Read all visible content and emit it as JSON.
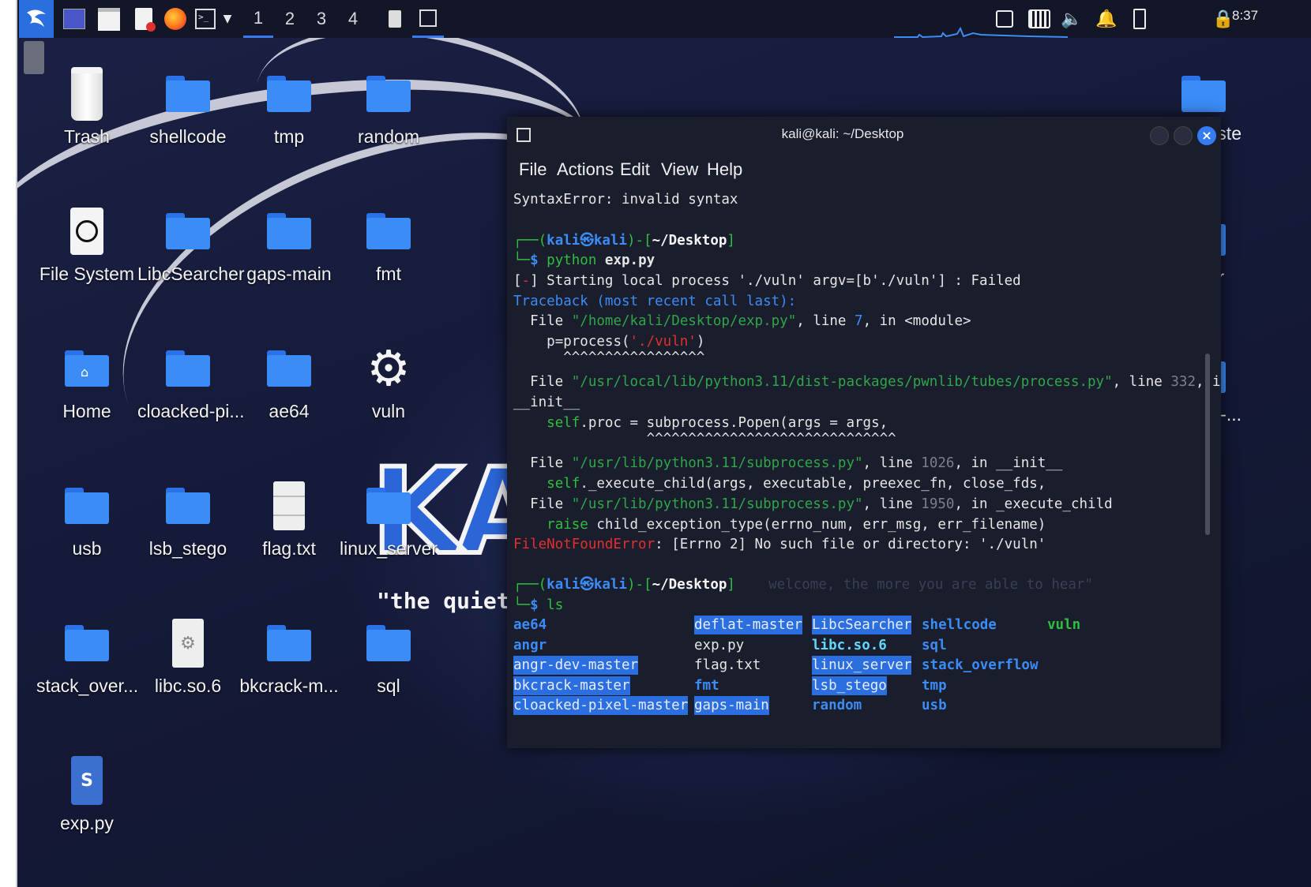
{
  "taskbar": {
    "workspaces": [
      "1",
      "2",
      "3",
      "4"
    ],
    "active_workspace": "1",
    "clock": "8:37"
  },
  "desktop_icons": [
    {
      "label": "Trash",
      "icon": "trash-icon"
    },
    {
      "label": "shellcode",
      "icon": "folder-icon"
    },
    {
      "label": "tmp",
      "icon": "folder-icon"
    },
    {
      "label": "random",
      "icon": "folder-icon"
    },
    {
      "label": "File System",
      "icon": "drive-icon"
    },
    {
      "label": "LibcSearcher",
      "icon": "folder-icon"
    },
    {
      "label": "gaps-main",
      "icon": "folder-icon"
    },
    {
      "label": "fmt",
      "icon": "folder-icon"
    },
    {
      "label": "Home",
      "icon": "home-folder-icon"
    },
    {
      "label": "cloacked-pi...",
      "icon": "folder-icon"
    },
    {
      "label": "ae64",
      "icon": "folder-icon"
    },
    {
      "label": "vuln",
      "icon": "gear-icon"
    },
    {
      "label": "usb",
      "icon": "folder-icon"
    },
    {
      "label": "lsb_stego",
      "icon": "folder-icon"
    },
    {
      "label": "flag.txt",
      "icon": "text-file-icon"
    },
    {
      "label": "linux_server",
      "icon": "folder-icon"
    },
    {
      "label": "stack_over...",
      "icon": "folder-icon"
    },
    {
      "label": "libc.so.6",
      "icon": "library-file-icon"
    },
    {
      "label": "bkcrack-m...",
      "icon": "folder-icon"
    },
    {
      "label": "sql",
      "icon": "folder-icon"
    },
    {
      "label": "exp.py",
      "icon": "python-file-icon"
    }
  ],
  "right_partial_labels": [
    "maste",
    "gr",
    "v-..."
  ],
  "wallpaper": {
    "logo_text": "KA",
    "tagline": "\"the quieter"
  },
  "terminal": {
    "title": "kali@kali: ~/Desktop",
    "menu": [
      "File",
      "Actions",
      "Edit",
      "View",
      "Help"
    ],
    "lines": {
      "syntax_error": "SyntaxError: invalid syntax",
      "prompt_user": "kali",
      "prompt_host": "kali",
      "prompt_dir": "~/Desktop",
      "cmd1_prog": "python",
      "cmd1_arg": "exp.py",
      "starting": "] Starting local process './vuln' argv=[b'./vuln'] : Failed",
      "traceback": "Traceback (most recent call last):",
      "file1_path": "\"/home/kali/Desktop/exp.py\"",
      "file1_line": "7",
      "file1_rest": ", in <module>",
      "code1_a": "p=process(",
      "code1_str": "'./vuln'",
      "code1_b": ")",
      "carets1": "^^^^^^^^^^^^^^^^^",
      "file2_path": "\"/usr/local/lib/python3.11/dist-packages/pwnlib/tubes/process.py\"",
      "file2_line": "332",
      "file2_rest": ", in",
      "init_cont": "__init__",
      "code2_self": "self",
      "code2_rest": ".proc = subprocess.Popen(args = args,",
      "carets2": "^^^^^^^^^^^^^^^^^^^^^^^^^^^^^^",
      "file3_path": "\"/usr/lib/python3.11/subprocess.py\"",
      "file3_line": "1026",
      "file3_rest": ", in __init__",
      "code3_self": "self",
      "code3_rest": "._execute_child(args, executable, preexec_fn, close_fds,",
      "file4_path": "\"/usr/lib/python3.11/subprocess.py\"",
      "file4_line": "1950",
      "file4_rest": ", in _execute_child",
      "code4_raise": "raise",
      "code4_rest": " child_exception_type(errno_num, err_msg, err_filename)",
      "error_name": "FileNotFoundError",
      "error_msg": ": [Errno 2] No such file or directory: './vuln'",
      "cmd2": "ls",
      "ghost_suggestion": "welcome, the more you are able to hear\""
    },
    "ls_output": [
      {
        "name": "ae64",
        "style": "dir"
      },
      {
        "name": "angr",
        "style": "dir"
      },
      {
        "name": "angr-dev-master",
        "style": "hl"
      },
      {
        "name": "bkcrack-master",
        "style": "hl"
      },
      {
        "name": "cloacked-pixel-master",
        "style": "hl"
      },
      {
        "name": "deflat-master",
        "style": "hl"
      },
      {
        "name": "exp.py",
        "style": "file"
      },
      {
        "name": "flag.txt",
        "style": "file"
      },
      {
        "name": "fmt",
        "style": "dir"
      },
      {
        "name": "gaps-main",
        "style": "hl"
      },
      {
        "name": "LibcSearcher",
        "style": "hl"
      },
      {
        "name": "libc.so.6",
        "style": "lib"
      },
      {
        "name": "linux_server",
        "style": "hl"
      },
      {
        "name": "lsb_stego",
        "style": "hl"
      },
      {
        "name": "random",
        "style": "dir"
      },
      {
        "name": "shellcode",
        "style": "dir"
      },
      {
        "name": "sql",
        "style": "dir"
      },
      {
        "name": "stack_overflow",
        "style": "dir"
      },
      {
        "name": "tmp",
        "style": "dir"
      },
      {
        "name": "usb",
        "style": "dir"
      },
      {
        "name": "vuln",
        "style": "exec"
      }
    ]
  },
  "colors": {
    "accent": "#367bf0",
    "dir": "#3b8cf6",
    "exec": "#2fbf3f",
    "error": "#e03030",
    "panel": "#131626",
    "terminal_bg": "#1a1d2c"
  }
}
